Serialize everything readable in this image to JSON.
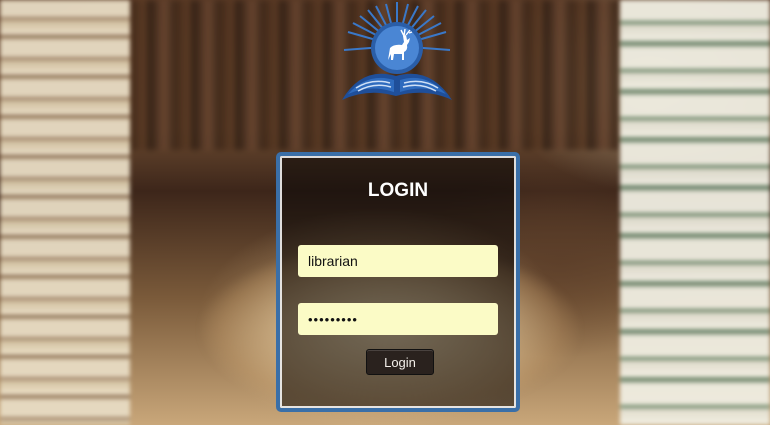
{
  "login": {
    "title": "LOGIN",
    "username_value": "librarian",
    "password_value": "•••••••••",
    "button_label": "Login"
  },
  "colors": {
    "card_border": "#3a6fa8",
    "field_bg": "#fbfbc6",
    "button_bg": "#2a221e",
    "logo_blue": "#2a5ea8"
  },
  "icons": {
    "logo": "deer-on-open-book-sunburst-logo"
  }
}
